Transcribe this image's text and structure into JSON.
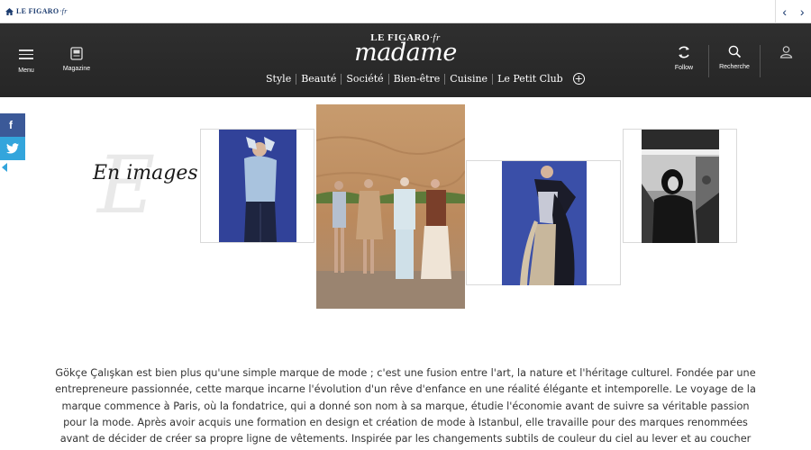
{
  "topbar": {
    "logo_text": "LE FIGARO",
    "logo_suffix": "·fr",
    "logo_icon": "home-icon",
    "prev_icon": "chevron-left-icon",
    "next_icon": "chevron-right-icon"
  },
  "header": {
    "menu_label": "Menu",
    "magazine_label": "Magazine",
    "brand_top": "LE FIGARO",
    "brand_top_suffix": "·fr",
    "brand_main": "madame",
    "follow_label": "Follow",
    "search_label": "Recherche",
    "nav": [
      "Style",
      "Beauté",
      "Société",
      "Bien-être",
      "Cuisine",
      "Le Petit Club"
    ],
    "more_icon": "plus-circle-icon"
  },
  "social": {
    "facebook": "f",
    "twitter_icon": "twitter-icon"
  },
  "section": {
    "watermark": "E",
    "title": "En images"
  },
  "article": {
    "body": "Gökçe Çalışkan est bien plus qu'une simple marque de mode ; c'est une fusion entre l'art, la nature et l'héritage culturel. Fondée par une entrepreneure passionnée, cette marque incarne l'évolution d'un rêve d'enfance en une réalité élégante et intemporelle. Le voyage de la marque commence à Paris, où la fondatrice, qui a donné son nom à sa marque, étudie l'économie avant de suivre sa véritable passion pour la mode. Après avoir acquis une formation en design et création de mode à Istanbul, elle travaille pour des marques renommées avant de décider de créer sa propre ligne de vêtements. Inspirée par les changements subtils de couleur du ciel au lever et au coucher"
  },
  "colors": {
    "header_bg": "#2b2b2b",
    "facebook": "#3b5998",
    "twitter": "#33a5dc",
    "brand_blue": "#1a3a6e"
  }
}
